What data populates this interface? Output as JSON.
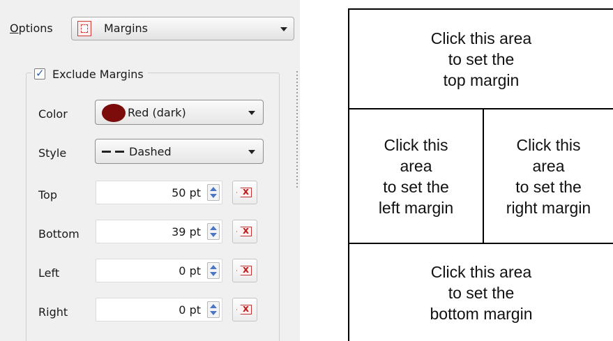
{
  "options": {
    "label_accel": "O",
    "label_rest": "ptions",
    "selected": "Margins",
    "icon": "margins-icon"
  },
  "exclude_margins": {
    "label": "Exclude Margins",
    "checked": true
  },
  "color": {
    "label": "Color",
    "value": "Red (dark)",
    "swatch_color": "#7c0b0b"
  },
  "style": {
    "label": "Style",
    "value": "Dashed",
    "icon": "dashed-line-icon"
  },
  "margins": {
    "top": {
      "label": "Top",
      "value": "50 pt"
    },
    "bottom": {
      "label": "Bottom",
      "value": "39 pt"
    },
    "left": {
      "label": "Left",
      "value": "0 pt"
    },
    "right": {
      "label": "Right",
      "value": "0 pt"
    }
  },
  "click_areas": {
    "top": [
      "Click this area",
      "to set the",
      "top margin"
    ],
    "left": [
      "Click this",
      "area",
      "to set the",
      "left margin"
    ],
    "right": [
      "Click this",
      "area",
      "to set the",
      "right margin"
    ],
    "bottom": [
      "Click this area",
      "to set the",
      "bottom margin"
    ]
  }
}
